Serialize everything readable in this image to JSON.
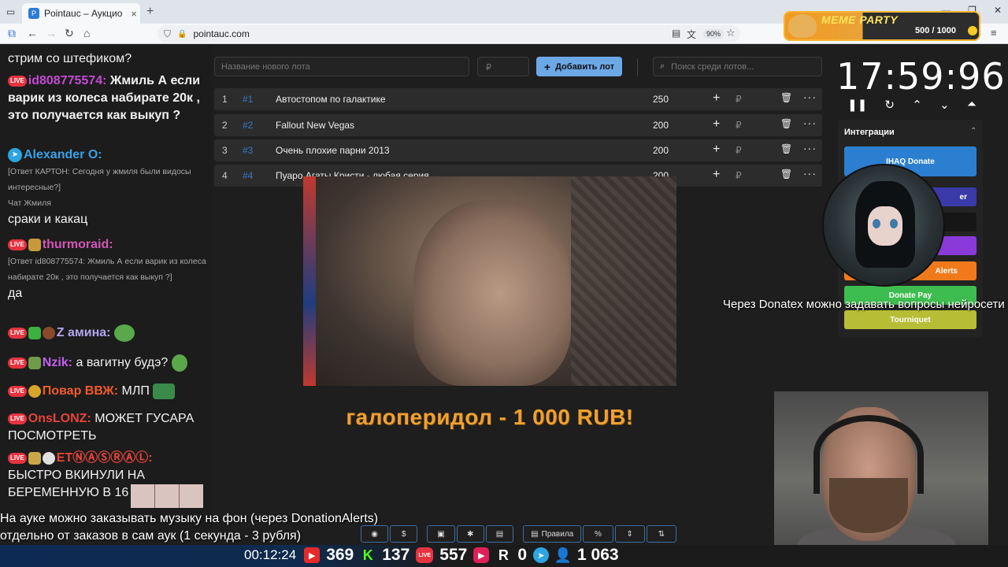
{
  "browser": {
    "tab_title": "Pointauc – Аукционы, лотереи",
    "tab_favicon": "P",
    "url": "pointauc.com",
    "zoom": "90%"
  },
  "meme_party": {
    "title": "MEME PARTY",
    "score": "500 / 1000"
  },
  "chat": {
    "messages": [
      {
        "text": "стрим со штефиком?"
      },
      {
        "nick": "id808775574:",
        "nick_color": "#c34bd3",
        "text": "Жмиль  А если варик из колеса набирате 20к , это получается как выкуп ?"
      },
      {
        "nick": "Alexander O:",
        "nick_color": "#3aa0e8",
        "reply": "[Ответ КАРТОН: Сегодня у жмиля были видосы интересные?]",
        "source": "Чат Жмиля",
        "text": "сраки и какац"
      },
      {
        "nick": "thurmoraid:",
        "nick_color": "#d457b8",
        "reply": "[Ответ id808775574: Жмиль  А если варик из колеса набирате 20к , это получается как выкуп ?]",
        "text": "да"
      },
      {
        "nick": "Z амина:",
        "nick_color": "#b3a7f0",
        "text": ""
      },
      {
        "nick": "Nzik:",
        "nick_color": "#c55ef0",
        "text": "а вагитну будэ?"
      },
      {
        "nick": "Повар ВВЖ:",
        "nick_color": "#f05a2a",
        "text": "МЛП"
      },
      {
        "nick": "OnsLONZ:",
        "nick_color": "#e8443a",
        "text": "МОЖЕТ ГУСАРА ПОСМОТРЕТЬ"
      },
      {
        "nick": "ЕТⓃⒶⓈⓇⒶⓁ:",
        "nick_color": "#e8443a",
        "text": "БЫСТРО ВКИНУЛИ НА БЕРЕМЕННУЮ В 16"
      }
    ],
    "live_badge": "LIVE"
  },
  "auction": {
    "lot_name_placeholder": "Название нового лота",
    "amount_placeholder": "₽",
    "add_lot_label": "Добавить лот",
    "search_placeholder": "Поиск среди лотов...",
    "lots": [
      {
        "index": "1",
        "fid": "#1",
        "name": "Автостопом по галактике",
        "amount": "250"
      },
      {
        "index": "2",
        "fid": "#2",
        "name": "Fallout New Vegas",
        "amount": "200"
      },
      {
        "index": "3",
        "fid": "#3",
        "name": "Очень плохие парни 2013",
        "amount": "200"
      },
      {
        "index": "4",
        "fid": "#4",
        "name": "Пуаро Агаты Кристи - любая серия",
        "amount": "200"
      }
    ],
    "rub_sign": "₽"
  },
  "donation_alert": "галоперидол - 1 000 RUB!",
  "timer": {
    "value": "17:59:96"
  },
  "integrations": {
    "header": "Интеграции",
    "buttons": [
      {
        "label": "IHAQ Donate",
        "color": "#2c7fd0"
      },
      {
        "label": "er",
        "color": "#3a3aa8"
      },
      {
        "label": "",
        "color": "#1a1a1a"
      },
      {
        "label": "",
        "color": "#8a3ad8"
      },
      {
        "label": "Alerts",
        "color": "#f07a1a"
      },
      {
        "label": "Donate Pay",
        "color": "#3dbd4f"
      },
      {
        "label": "Tourniquet",
        "color": "#b7bd35"
      }
    ]
  },
  "overlay": {
    "donatex_text": "Через Donatex можно задавать вопросы нейросети",
    "ticker_line1": "На ауке можно заказывать музыку на фон (через DonationAlerts)",
    "ticker_line2": "отдельно от заказов в сам аук (1 секунда - 3 рубля)",
    "rules_label": "Правила"
  },
  "stats": {
    "uptime": "00:12:24",
    "youtube": "369",
    "kick": "137",
    "vk_live": "557",
    "vk_video": "",
    "rutube": "0",
    "telegram": "",
    "viewers": "1 063"
  },
  "colors": {
    "accent": "#6da8e6",
    "live_red": "#e5333f",
    "donation_orange": "#f0a030"
  }
}
